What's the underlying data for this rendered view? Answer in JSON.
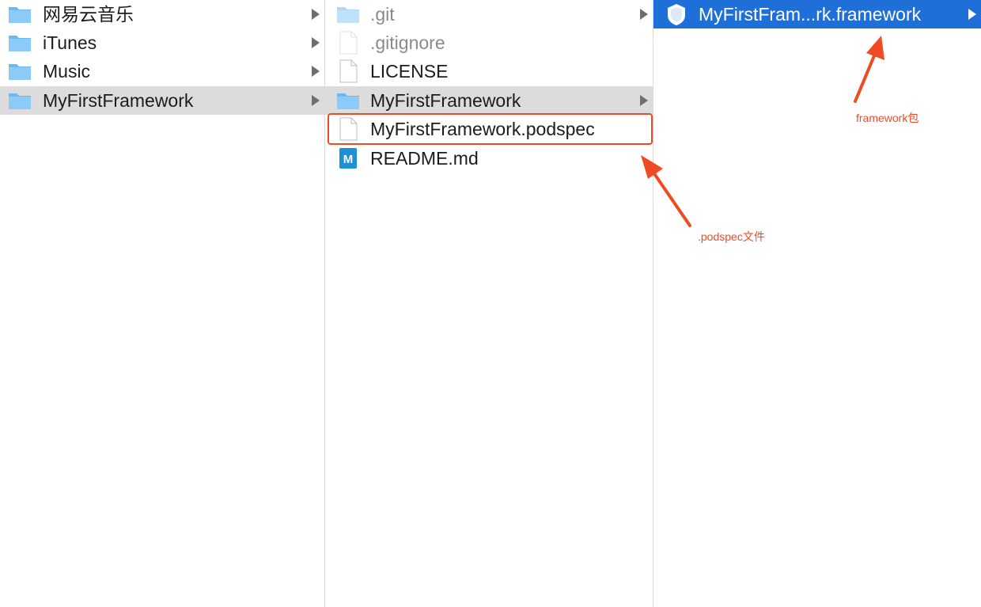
{
  "column1": {
    "items": [
      {
        "label": "网易云音乐",
        "icon": "folder-icon",
        "has_children": true,
        "selected": false
      },
      {
        "label": "iTunes",
        "icon": "folder-icon",
        "has_children": true,
        "selected": false
      },
      {
        "label": "Music",
        "icon": "folder-icon",
        "has_children": true,
        "selected": false
      },
      {
        "label": "MyFirstFramework",
        "icon": "folder-icon",
        "has_children": true,
        "selected": true
      }
    ]
  },
  "column2": {
    "items": [
      {
        "label": ".git",
        "icon": "folder-icon",
        "has_children": true,
        "dim": true
      },
      {
        "label": ".gitignore",
        "icon": "file-icon",
        "has_children": false,
        "dim": true
      },
      {
        "label": "LICENSE",
        "icon": "file-icon",
        "has_children": false,
        "dim": false
      },
      {
        "label": "MyFirstFramework",
        "icon": "folder-icon",
        "has_children": true,
        "selected": true
      },
      {
        "label": "MyFirstFramework.podspec",
        "icon": "file-icon",
        "has_children": false,
        "highlighted": true
      },
      {
        "label": "README.md",
        "icon": "markdown-icon",
        "has_children": false
      }
    ]
  },
  "column3": {
    "items": [
      {
        "label": "MyFirstFram...rk.framework",
        "icon": "framework-icon",
        "has_children": true,
        "selected": true
      }
    ]
  },
  "annotations": {
    "framework": "framework包",
    "podspec": ".podspec文件"
  },
  "colors": {
    "selection_blue": "#1f6fd9",
    "selection_gray": "#dcdcdc",
    "annotation_red": "#ef4a23",
    "folder_blue": "#6cb8f0"
  }
}
